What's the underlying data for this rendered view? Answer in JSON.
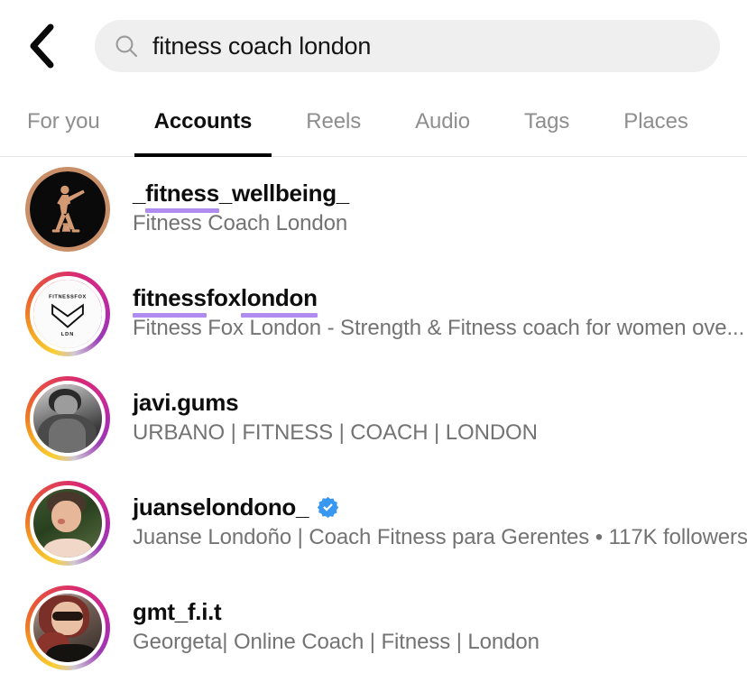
{
  "header": {
    "back_icon": "back-chevron-icon",
    "search": {
      "icon": "search-icon",
      "value": "fitness coach london",
      "placeholder": "Search"
    }
  },
  "tabs": [
    {
      "label": "For you",
      "active": false
    },
    {
      "label": "Accounts",
      "active": true
    },
    {
      "label": "Reels",
      "active": false
    },
    {
      "label": "Audio",
      "active": false
    },
    {
      "label": "Tags",
      "active": false
    },
    {
      "label": "Places",
      "active": false
    }
  ],
  "colors": {
    "highlight_underline": "#b18cf0",
    "search_background": "#efefef",
    "active_tab": "#000000",
    "inactive_tab": "#8e8e8e",
    "subtitle": "#737373",
    "verified_badge": "#3897f0",
    "bronze_ring": "#c98f68"
  },
  "results": [
    {
      "username": "_fitness_wellbeing_",
      "username_parts": [
        {
          "t": "_",
          "hl": false
        },
        {
          "t": "fitness",
          "hl": true
        },
        {
          "t": "_wellbeing_",
          "hl": false
        }
      ],
      "subtitle": "Fitness Coach London",
      "subtitle_parts": [
        {
          "t": "Fitness Coach London",
          "hl": true
        }
      ],
      "verified": false,
      "ring": "bronze",
      "avatar": "dark-athlete-silhouette"
    },
    {
      "username": "fitnessfoxlondon",
      "username_parts": [
        {
          "t": "fitness",
          "hl": true
        },
        {
          "t": "fox",
          "hl": false
        },
        {
          "t": "london",
          "hl": true
        }
      ],
      "subtitle": "Fitness Fox London - Strength & Fitness coach for women ove...",
      "subtitle_parts": [
        {
          "t": "Fitness",
          "hl": true
        },
        {
          "t": " Fox ",
          "hl": false
        },
        {
          "t": "London",
          "hl": true
        },
        {
          "t": " - Strength & Fitness ",
          "hl": false
        },
        {
          "t": "coach",
          "hl": true
        },
        {
          "t": " for women ove...",
          "hl": false
        }
      ],
      "verified": false,
      "ring": "gradient",
      "avatar": "fitnessfox-lon-logo"
    },
    {
      "username": "javi.gums",
      "username_parts": [
        {
          "t": "javi.gums",
          "hl": false
        }
      ],
      "subtitle": "URBANO | FITNESS | COACH | LONDON",
      "subtitle_parts": [
        {
          "t": "URBANO | ",
          "hl": false
        },
        {
          "t": "FITNESS",
          "hl": true
        },
        {
          "t": " | ",
          "hl": false
        },
        {
          "t": "COACH",
          "hl": true
        },
        {
          "t": " | ",
          "hl": false
        },
        {
          "t": "LONDON",
          "hl": true
        }
      ],
      "verified": false,
      "ring": "gradient",
      "avatar": "bw-portrait-man"
    },
    {
      "username": "juanselondono_",
      "username_parts": [
        {
          "t": "juanselondono_",
          "hl": false
        }
      ],
      "subtitle": "Juanse Londoño | Coach Fitness para Gerentes • 117K followers",
      "subtitle_parts": [
        {
          "t": "Juanse Londoño | ",
          "hl": false
        },
        {
          "t": "Coach Fitness",
          "hl": true
        },
        {
          "t": " para Gerentes • 117K followers",
          "hl": false
        }
      ],
      "verified": true,
      "followers": "117K followers",
      "ring": "gradient",
      "avatar": "portrait-man-green-background"
    },
    {
      "username": "gmt_f.i.t",
      "username_parts": [
        {
          "t": "gmt_f.i.t",
          "hl": false
        }
      ],
      "subtitle": "Georgeta| Online Coach | Fitness | London",
      "subtitle_parts": [
        {
          "t": "Georgeta| ",
          "hl": false
        },
        {
          "t": "Online Coach",
          "hl": true
        },
        {
          "t": " | ",
          "hl": false
        },
        {
          "t": "Fitness",
          "hl": true
        },
        {
          "t": " | ",
          "hl": false
        },
        {
          "t": "London",
          "hl": true
        }
      ],
      "verified": false,
      "ring": "gradient",
      "avatar": "portrait-woman-sunglasses"
    }
  ]
}
